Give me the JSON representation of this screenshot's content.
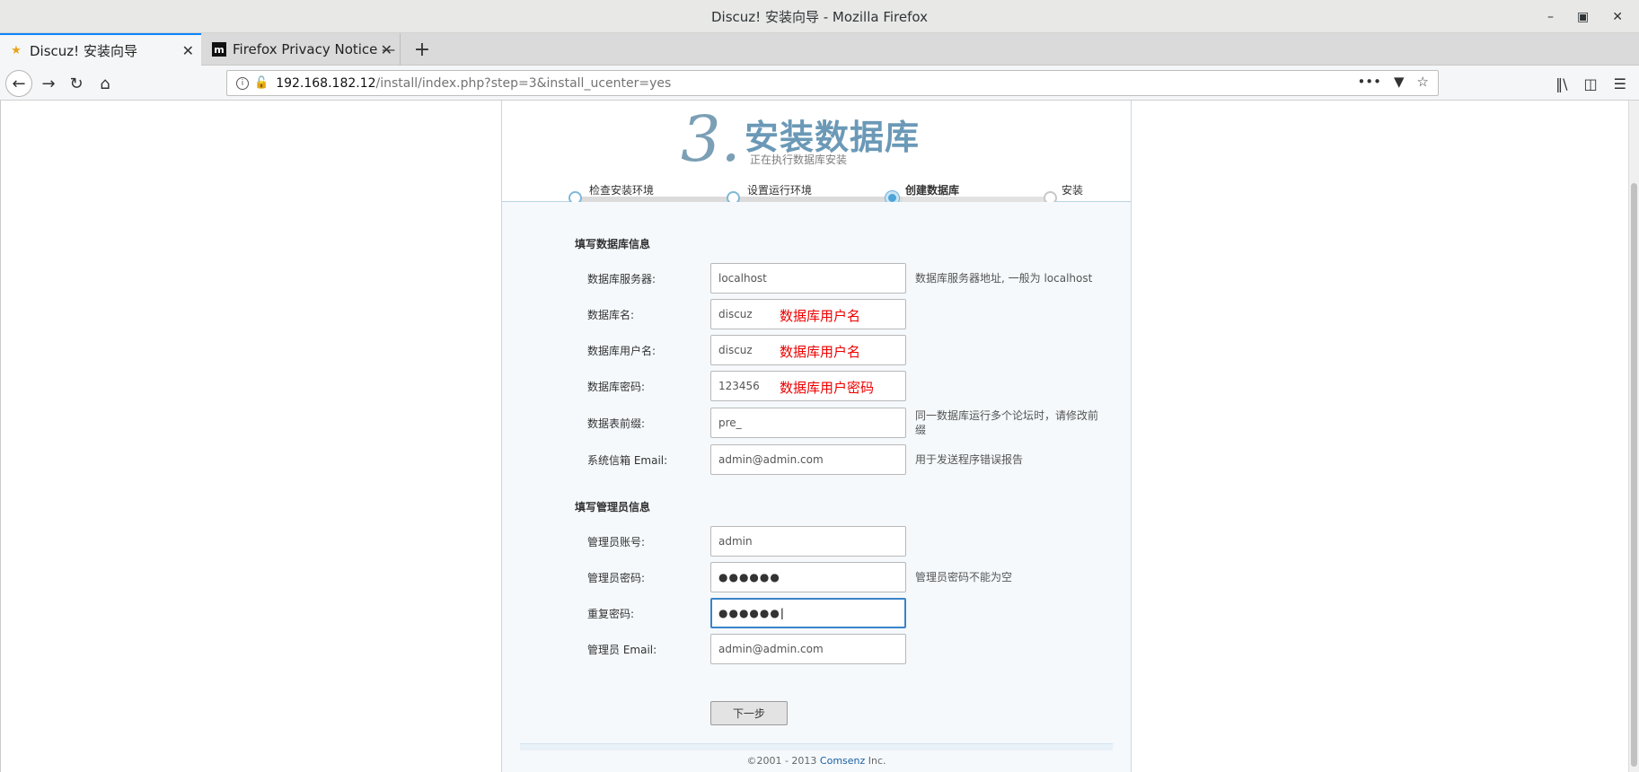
{
  "window": {
    "title": "Discuz! 安装向导  -  Mozilla Firefox"
  },
  "tabs": [
    {
      "label": "Discuz! 安装向导",
      "icon": "discuz-favicon"
    },
    {
      "label": "Firefox Privacy Notice —",
      "icon": "mozilla-favicon"
    }
  ],
  "url": {
    "host": "192.168.182.12",
    "path": "/install/index.php?step=3&install_ucenter=yes"
  },
  "page": {
    "step_number": "3.",
    "step_title": "安装数据库",
    "step_subtitle": "正在执行数据库安装",
    "steps": [
      {
        "label": "检查安装环境",
        "state": "done"
      },
      {
        "label": "设置运行环境",
        "state": "done"
      },
      {
        "label": "创建数据库",
        "state": "current"
      },
      {
        "label": "安装",
        "state": "todo"
      }
    ],
    "db_section_title": "填写数据库信息",
    "db_fields": [
      {
        "label": "数据库服务器:",
        "value": "localhost",
        "hint": "数据库服务器地址, 一般为 localhost",
        "annotation": ""
      },
      {
        "label": "数据库名:",
        "value": "discuz",
        "hint": "",
        "annotation": "数据库用户名"
      },
      {
        "label": "数据库用户名:",
        "value": "discuz",
        "hint": "",
        "annotation": "数据库用户名"
      },
      {
        "label": "数据库密码:",
        "value": "123456",
        "hint": "",
        "annotation": "数据库用户密码"
      },
      {
        "label": "数据表前缀:",
        "value": "pre_",
        "hint": "同一数据库运行多个论坛时，请修改前缀",
        "annotation": ""
      },
      {
        "label": "系统信箱 Email:",
        "value": "admin@admin.com",
        "hint": "用于发送程序错误报告",
        "annotation": ""
      }
    ],
    "admin_section_title": "填写管理员信息",
    "admin_fields": [
      {
        "label": "管理员账号:",
        "value": "admin",
        "hint": ""
      },
      {
        "label": "管理员密码:",
        "value": "●●●●●●",
        "hint": "管理员密码不能为空"
      },
      {
        "label": "重复密码:",
        "value": "●●●●●●",
        "hint": ""
      },
      {
        "label": "管理员 Email:",
        "value": "admin@admin.com",
        "hint": ""
      }
    ],
    "next_button": "下一步",
    "footer_prefix": "©2001 - 2013 ",
    "footer_link": "Comsenz",
    "footer_suffix": " Inc."
  }
}
